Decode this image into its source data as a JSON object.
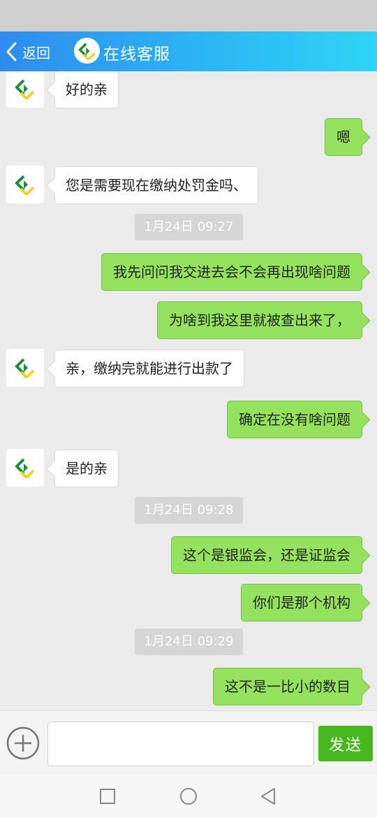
{
  "header": {
    "back_label": "返回",
    "title": "在线客服"
  },
  "colors": {
    "header_gradient_start": "#2f8bf0",
    "header_gradient_end": "#2fd4f6",
    "outgoing_bubble": "#95e25e",
    "send_button": "#46b81e"
  },
  "messages": [
    {
      "side": "in",
      "text": "好的亲"
    },
    {
      "side": "out",
      "text": "嗯"
    },
    {
      "side": "in",
      "text": "您是需要现在缴纳处罚金吗、"
    },
    {
      "timestamp": "1月24日 09:27"
    },
    {
      "side": "out",
      "text": "我先问问我交进去会不会再出现啥问题"
    },
    {
      "side": "out",
      "text": "为啥到我这里就被查出来了，"
    },
    {
      "side": "in",
      "text": "亲，缴纳完就能进行出款了"
    },
    {
      "side": "out",
      "text": "确定在没有啥问题"
    },
    {
      "side": "in",
      "text": "是的亲"
    },
    {
      "timestamp": "1月24日 09:28"
    },
    {
      "side": "out",
      "text": "这个是银监会，还是证监会"
    },
    {
      "side": "out",
      "text": "你们是那个机构"
    },
    {
      "timestamp": "1月24日 09:29"
    },
    {
      "side": "out",
      "text": "这不是一比小的数目"
    }
  ],
  "input": {
    "value": "",
    "placeholder": ""
  },
  "send_label": "发送",
  "icons": {
    "back": "chevron-left-icon",
    "agent_logo": "service-logo-icon",
    "attach": "plus-circle-icon",
    "nav_recent": "square-icon",
    "nav_home": "circle-icon",
    "nav_back": "triangle-back-icon"
  }
}
